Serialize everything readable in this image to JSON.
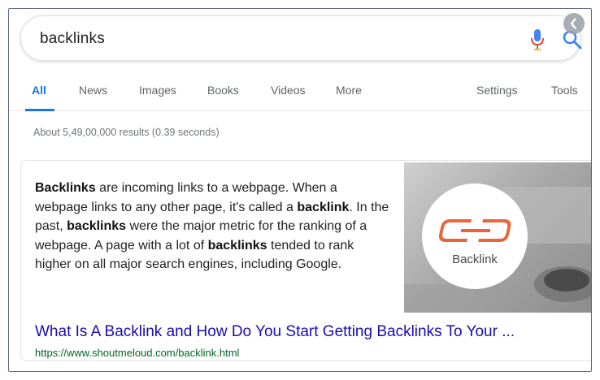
{
  "search": {
    "query": "backlinks"
  },
  "tabs": {
    "items": [
      {
        "label": "All",
        "active": true
      },
      {
        "label": "News",
        "active": false
      },
      {
        "label": "Images",
        "active": false
      },
      {
        "label": "Books",
        "active": false
      },
      {
        "label": "Videos",
        "active": false
      },
      {
        "label": "More",
        "active": false
      }
    ],
    "settings_label": "Settings",
    "tools_label": "Tools"
  },
  "results": {
    "stats": "About 5,49,00,000 results (0.39 seconds)"
  },
  "snippet": {
    "segments": [
      {
        "text": "Backlinks",
        "bold": true
      },
      {
        "text": " are incoming links to a webpage. When a webpage links to any other page, it's called a ",
        "bold": false
      },
      {
        "text": "backlink",
        "bold": true
      },
      {
        "text": ". In the past, ",
        "bold": false
      },
      {
        "text": "backlinks",
        "bold": true
      },
      {
        "text": " were the major metric for the ranking of a webpage. A page with a lot of ",
        "bold": false
      },
      {
        "text": "backlinks",
        "bold": true
      },
      {
        "text": " tended to rank higher on all major search engines, including Google.",
        "bold": false
      }
    ],
    "image_label": "Backlink",
    "title": "What Is A Backlink and How Do You Start Getting Backlinks To Your ...",
    "url": "https://www.shoutmeloud.com/backlink.html"
  },
  "colors": {
    "accent": "#1a73e8",
    "link": "#1a0dab",
    "url": "#006621",
    "mic_red": "#ea4335",
    "mic_blue": "#4285f4",
    "logo_orange": "#e8663a"
  },
  "icons": {
    "mic": "microphone-icon",
    "search": "search-icon",
    "logo": "chain-link-icon",
    "corner": "chevron-left-icon"
  }
}
